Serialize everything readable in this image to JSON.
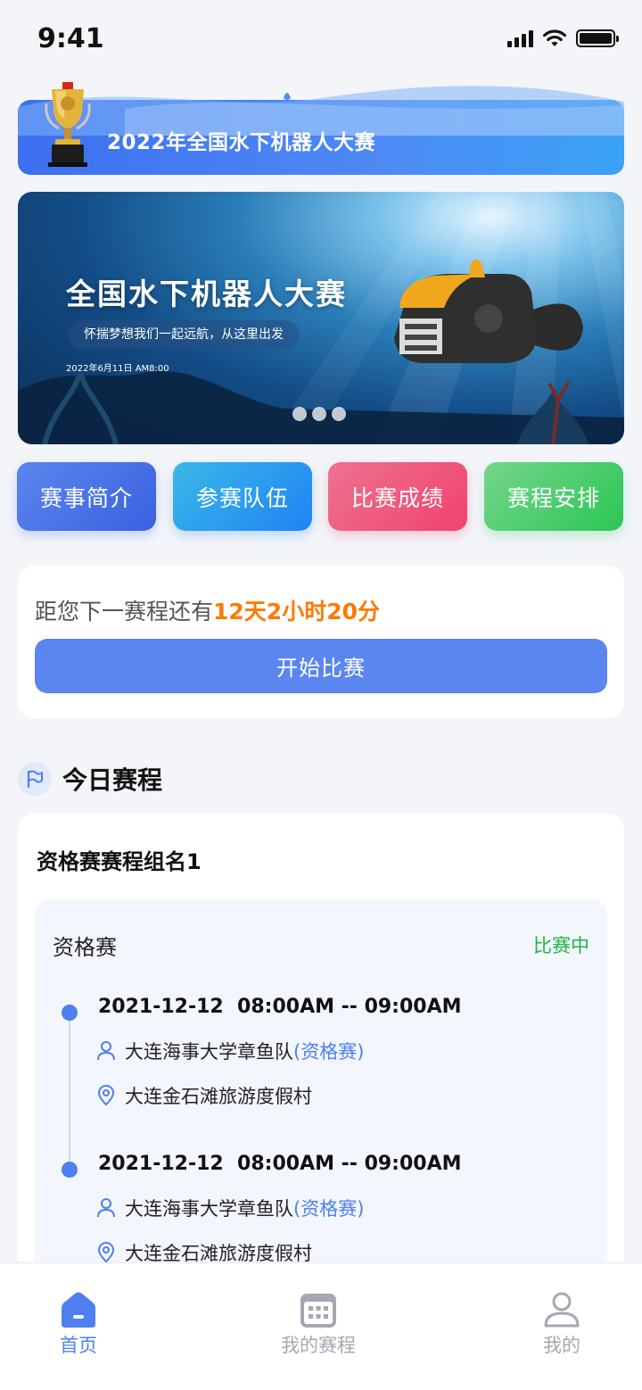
{
  "status_bar": {
    "time": "9:41"
  },
  "header": {
    "title": "2022年全国水下机器人大赛"
  },
  "hero": {
    "title": "全国水下机器人大赛",
    "slogan": "怀揣梦想我们一起远航，从这里出发",
    "date": "2022年6月11日 AM8:00",
    "slide_count": 3
  },
  "quick_actions": [
    {
      "label": "赛事简介",
      "color": "#4a74e8"
    },
    {
      "label": "参赛队伍",
      "color": "#2a9cf0"
    },
    {
      "label": "比赛成绩",
      "color": "#f0567a"
    },
    {
      "label": "赛程安排",
      "color": "#3dcb66"
    }
  ],
  "countdown": {
    "prefix": "距您下一赛程还有",
    "value": "12天2小时20分",
    "button_label": "开始比赛"
  },
  "today": {
    "section_title": "今日赛程",
    "group_name": "资格赛赛程组名1",
    "round": "资格赛",
    "status": "比赛中",
    "entries": [
      {
        "time": "2021-12-12  08:00AM -- 09:00AM",
        "team": "大连海事大学章鱼队",
        "team_tag": "(资格赛)",
        "location": "大连金石滩旅游度假村"
      },
      {
        "time": "2021-12-12  08:00AM -- 09:00AM",
        "team": "大连海事大学章鱼队",
        "team_tag": "(资格赛)",
        "location": "大连金石滩旅游度假村"
      }
    ]
  },
  "tabbar": {
    "items": [
      {
        "label": "首页",
        "icon": "home-icon",
        "active": true
      },
      {
        "label": "我的赛程",
        "icon": "calendar-icon",
        "active": false
      },
      {
        "label": "我的",
        "icon": "user-icon",
        "active": false
      }
    ]
  },
  "colors": {
    "primary": "#4f7ff0",
    "accent_orange": "#ff7a00",
    "status_green": "#1fb541"
  }
}
